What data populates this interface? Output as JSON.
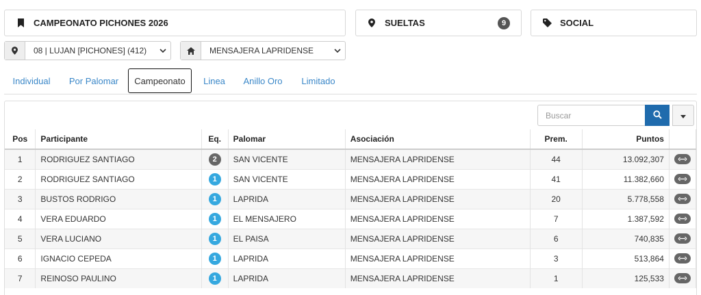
{
  "cards": {
    "championship": {
      "label": "CAMPEONATO PICHONES 2026"
    },
    "sueltas": {
      "label": "SUELTAS",
      "count": "9"
    },
    "social": {
      "label": "SOCIAL"
    }
  },
  "filters": {
    "location": {
      "value": "08 | LUJAN [PICHONES] (412)"
    },
    "club": {
      "value": "MENSAJERA LAPRIDENSE"
    }
  },
  "tabs": [
    {
      "label": "Individual"
    },
    {
      "label": "Por Palomar"
    },
    {
      "label": "Campeonato",
      "active": true
    },
    {
      "label": "Linea"
    },
    {
      "label": "Anillo Oro"
    },
    {
      "label": "Limitado"
    }
  ],
  "search": {
    "placeholder": "Buscar"
  },
  "table": {
    "headers": {
      "pos": "Pos",
      "participante": "Participante",
      "eq": "Eq.",
      "palomar": "Palomar",
      "asociacion": "Asociación",
      "prem": "Prem.",
      "puntos": "Puntos"
    },
    "rows": [
      {
        "pos": "1",
        "participante": "RODRIGUEZ SANTIAGO",
        "eq": "2",
        "palomar": "SAN VICENTE",
        "asociacion": "MENSAJERA LAPRIDENSE",
        "prem": "44",
        "puntos": "13.092,307"
      },
      {
        "pos": "2",
        "participante": "RODRIGUEZ SANTIAGO",
        "eq": "1",
        "palomar": "SAN VICENTE",
        "asociacion": "MENSAJERA LAPRIDENSE",
        "prem": "41",
        "puntos": "11.382,660"
      },
      {
        "pos": "3",
        "participante": "BUSTOS RODRIGO",
        "eq": "1",
        "palomar": "LAPRIDA",
        "asociacion": "MENSAJERA LAPRIDENSE",
        "prem": "20",
        "puntos": "5.778,558"
      },
      {
        "pos": "4",
        "participante": "VERA EDUARDO",
        "eq": "1",
        "palomar": "EL MENSAJERO",
        "asociacion": "MENSAJERA LAPRIDENSE",
        "prem": "7",
        "puntos": "1.387,592"
      },
      {
        "pos": "5",
        "participante": "VERA LUCIANO",
        "eq": "1",
        "palomar": "EL PAISA",
        "asociacion": "MENSAJERA LAPRIDENSE",
        "prem": "6",
        "puntos": "740,835"
      },
      {
        "pos": "6",
        "participante": "IGNACIO CEPEDA",
        "eq": "1",
        "palomar": "LAPRIDA",
        "asociacion": "MENSAJERA LAPRIDENSE",
        "prem": "3",
        "puntos": "513,864"
      },
      {
        "pos": "7",
        "participante": "REINOSO PAULINO",
        "eq": "1",
        "palomar": "LAPRIDA",
        "asociacion": "MENSAJERA LAPRIDENSE",
        "prem": "1",
        "puntos": "125,533"
      }
    ]
  },
  "colors": {
    "accent": "#1f6bad",
    "link": "#3a87c8",
    "badge_primary": "#35a8df",
    "badge_dark": "#666666"
  },
  "icons": {
    "championship": "bookmark-icon",
    "sueltas": "map-pin-icon",
    "social": "tag-icon",
    "location": "map-pin-icon",
    "club": "home-icon",
    "search": "search-icon",
    "row_action": "expand-horizontal-icon"
  }
}
